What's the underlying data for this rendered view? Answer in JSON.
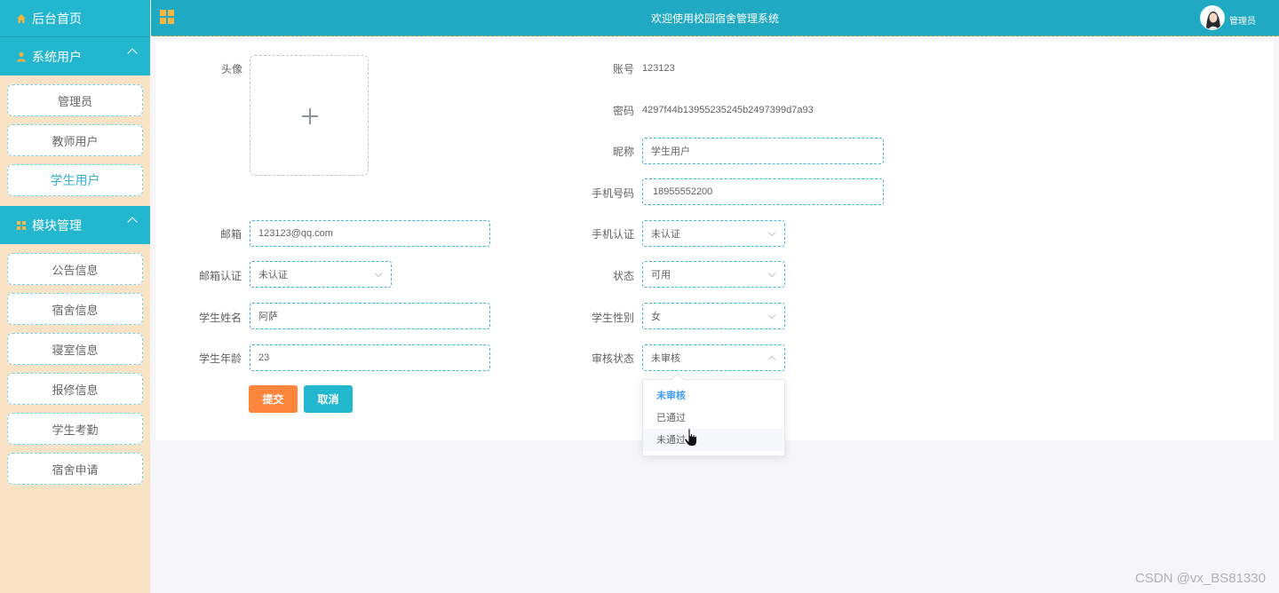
{
  "sidebar": {
    "home": "后台首页",
    "groups": [
      {
        "label": "系统用户",
        "items": [
          "管理员",
          "教师用户",
          "学生用户"
        ]
      },
      {
        "label": "模块管理",
        "items": [
          "公告信息",
          "宿舍信息",
          "寝室信息",
          "报修信息",
          "学生考勤",
          "宿舍申请"
        ]
      }
    ],
    "active_item": "学生用户"
  },
  "header": {
    "title": "欢迎使用校园宿舍管理系统",
    "user": "管理员"
  },
  "form": {
    "avatar_label": "头像",
    "account_label": "账号",
    "account_value": "123123",
    "password_label": "密码",
    "password_value": "4297f44b13955235245b2497399d7a93",
    "nickname_label": "昵称",
    "nickname_value": "学生用户",
    "phone_label": "手机号码",
    "phone_value": "18955552200",
    "email_label": "邮箱",
    "email_value": "123123@qq.com",
    "phone_verify_label": "手机认证",
    "phone_verify_value": "未认证",
    "email_verify_label": "邮箱认证",
    "email_verify_value": "未认证",
    "status_label": "状态",
    "status_value": "可用",
    "student_name_label": "学生姓名",
    "student_name_value": "阿萨",
    "gender_label": "学生性别",
    "gender_value": "女",
    "age_label": "学生年龄",
    "age_value": "23",
    "review_label": "审核状态",
    "review_value": "未审核",
    "submit": "提交",
    "cancel": "取消"
  },
  "dropdown": {
    "options": [
      "未审核",
      "已通过",
      "未通过"
    ],
    "selected": "未审核",
    "hovered": "未通过"
  },
  "watermark": "CSDN @vx_BS81330",
  "colors": {
    "primary": "#23b7cf",
    "accent_orange": "#fd853c",
    "sidebar_bg": "#fae3c4",
    "link_blue": "#409eff"
  }
}
